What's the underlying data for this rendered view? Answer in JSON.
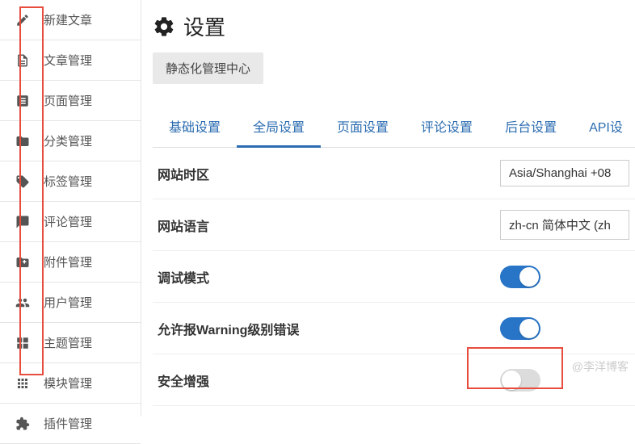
{
  "sidebar": {
    "items": [
      {
        "icon": "edit",
        "label": "新建文章"
      },
      {
        "icon": "doc",
        "label": "文章管理"
      },
      {
        "icon": "page",
        "label": "页面管理"
      },
      {
        "icon": "folder",
        "label": "分类管理"
      },
      {
        "icon": "tag",
        "label": "标签管理"
      },
      {
        "icon": "comment",
        "label": "评论管理"
      },
      {
        "icon": "attach",
        "label": "附件管理"
      },
      {
        "icon": "users",
        "label": "用户管理"
      },
      {
        "icon": "theme",
        "label": "主题管理"
      },
      {
        "icon": "modules",
        "label": "模块管理"
      },
      {
        "icon": "plugin",
        "label": "插件管理"
      }
    ]
  },
  "page": {
    "title": "设置",
    "subaction": "静态化管理中心"
  },
  "tabs": [
    {
      "label": "基础设置",
      "active": false
    },
    {
      "label": "全局设置",
      "active": true
    },
    {
      "label": "页面设置",
      "active": false
    },
    {
      "label": "评论设置",
      "active": false
    },
    {
      "label": "后台设置",
      "active": false
    },
    {
      "label": "API设",
      "active": false
    }
  ],
  "settings": [
    {
      "label": "网站时区",
      "type": "select",
      "value": "Asia/Shanghai +08"
    },
    {
      "label": "网站语言",
      "type": "select",
      "value": "zh-cn 简体中文 (zh"
    },
    {
      "label": "调试模式",
      "type": "switch",
      "value": true
    },
    {
      "label": "允许报Warning级别错误",
      "type": "switch",
      "value": true
    },
    {
      "label": "安全增强",
      "type": "switch",
      "value": false
    }
  ],
  "watermark": "@李洋博客"
}
